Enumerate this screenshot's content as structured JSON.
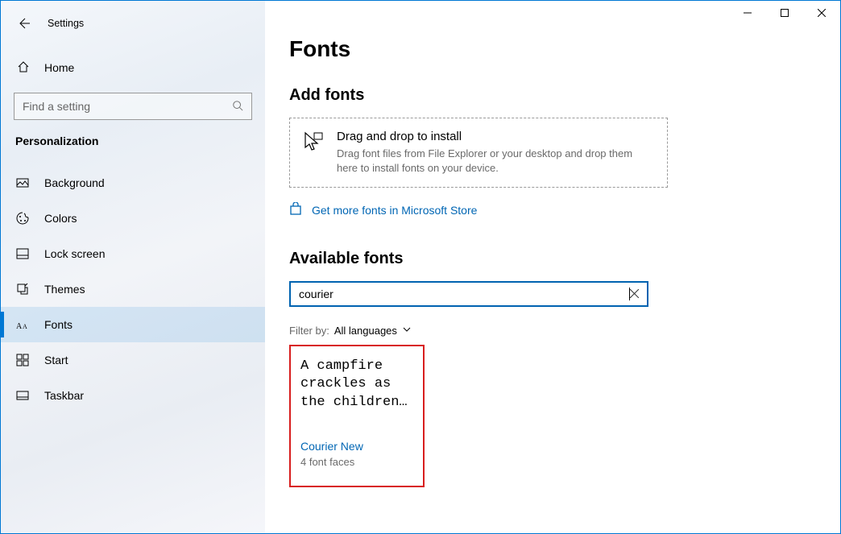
{
  "window": {
    "title": "Settings"
  },
  "sidebar": {
    "home_label": "Home",
    "search_placeholder": "Find a setting",
    "section_label": "Personalization",
    "items": [
      {
        "label": "Background"
      },
      {
        "label": "Colors"
      },
      {
        "label": "Lock screen"
      },
      {
        "label": "Themes"
      },
      {
        "label": "Fonts"
      },
      {
        "label": "Start"
      },
      {
        "label": "Taskbar"
      }
    ]
  },
  "main": {
    "heading": "Fonts",
    "add_fonts_heading": "Add fonts",
    "dropzone": {
      "title": "Drag and drop to install",
      "subtitle": "Drag font files from File Explorer or your desktop and drop them here to install fonts on your device."
    },
    "store_link": "Get more fonts in Microsoft Store",
    "available_heading": "Available fonts",
    "filter_input_value": "courier",
    "filter_label": "Filter by:",
    "filter_value": "All languages",
    "font_card": {
      "sample": "A campfire crackles as the children…",
      "name": "Courier New",
      "faces": "4 font faces"
    }
  }
}
